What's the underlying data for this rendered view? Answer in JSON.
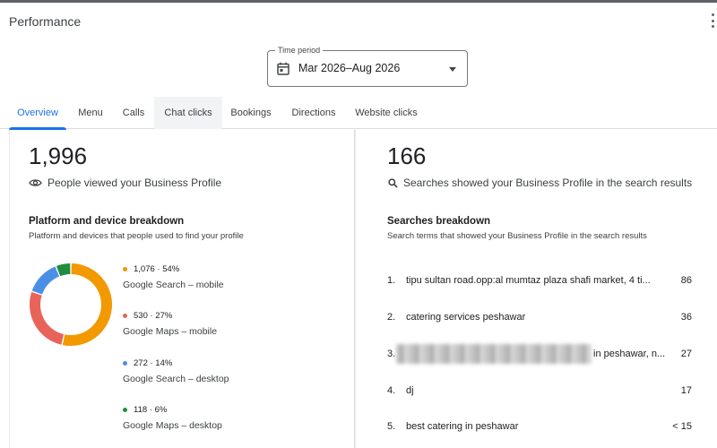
{
  "page_title": "Performance",
  "time_period": {
    "label": "Time period",
    "value": "Mar 2026–Aug 2026"
  },
  "tabs": [
    {
      "label": "Overview"
    },
    {
      "label": "Menu"
    },
    {
      "label": "Calls"
    },
    {
      "label": "Chat clicks"
    },
    {
      "label": "Bookings"
    },
    {
      "label": "Directions"
    },
    {
      "label": "Website clicks"
    }
  ],
  "left_card": {
    "total": "1,996",
    "subtitle": "People viewed your Business Profile",
    "section_title": "Platform and device breakdown",
    "section_desc": "Platform and devices that people used to find your profile",
    "breakdown": [
      {
        "stat": "1,076 · 54%",
        "name": "Google Search – mobile",
        "color": "#f29900",
        "fraction": 0.54
      },
      {
        "stat": "530 · 27%",
        "name": "Google Maps – mobile",
        "color": "#e8635a",
        "fraction": 0.27
      },
      {
        "stat": "272 · 14%",
        "name": "Google Search – desktop",
        "color": "#4a8fe7",
        "fraction": 0.14
      },
      {
        "stat": "118 · 6%",
        "name": "Google Maps – desktop",
        "color": "#1e8e3e",
        "fraction": 0.06
      }
    ]
  },
  "right_card": {
    "total": "166",
    "subtitle": "Searches showed your Business Profile in the search results",
    "section_title": "Searches breakdown",
    "section_desc": "Search terms that showed your Business Profile in the search results",
    "searches": [
      {
        "rank": "1.",
        "term": "tipu sultan road.opp:al mumtaz plaza shafi market, 4 ti...",
        "count": "86"
      },
      {
        "rank": "2.",
        "term": "catering services peshawar",
        "count": "36"
      },
      {
        "rank": "3.",
        "term": "in peshawar, n...",
        "count": "27"
      },
      {
        "rank": "4.",
        "term": "dj",
        "count": "17"
      },
      {
        "rank": "5.",
        "term": "best catering in peshawar",
        "count": "< 15"
      }
    ]
  }
}
